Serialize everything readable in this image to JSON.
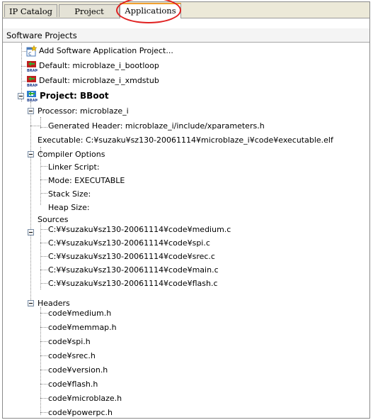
{
  "tabs": [
    {
      "label": "IP Catalog"
    },
    {
      "label": "Project"
    },
    {
      "label": "Applications"
    }
  ],
  "panel_title": "Software Projects",
  "tree": {
    "add_app": "Add Software Application Project...",
    "default_bootloop": "Default: microblaze_i_bootloop",
    "default_xmdstub": "Default: microblaze_i_xmdstub",
    "project": "Project: BBoot",
    "processor": "Processor: microblaze_i",
    "generated_header": "Generated Header: microblaze_i/include/xparameters.h",
    "executable": "Executable: C:¥suzaku¥sz130-20061114¥microblaze_i¥code¥executable.elf",
    "compiler_options": "Compiler Options",
    "linker_script": "Linker Script:",
    "mode": "Mode: EXECUTABLE",
    "stack_size": "Stack Size:",
    "heap_size": "Heap Size:",
    "sources_label": "Sources",
    "sources": [
      "C:¥¥suzaku¥sz130-20061114¥code¥medium.c",
      "C:¥¥suzaku¥sz130-20061114¥code¥spi.c",
      "C:¥¥suzaku¥sz130-20061114¥code¥srec.c",
      "C:¥¥suzaku¥sz130-20061114¥code¥main.c",
      "C:¥¥suzaku¥sz130-20061114¥code¥flash.c"
    ],
    "headers_label": "Headers",
    "headers": [
      "code¥medium.h",
      "code¥memmap.h",
      "code¥spi.h",
      "code¥srec.h",
      "code¥version.h",
      "code¥flash.h",
      "code¥microblaze.h",
      "code¥powerpc.h"
    ]
  },
  "colors": {
    "highlight_circle": "#e02020",
    "active_tab_accent": "#f0a030",
    "tree_lines": "#8c8c8c"
  }
}
